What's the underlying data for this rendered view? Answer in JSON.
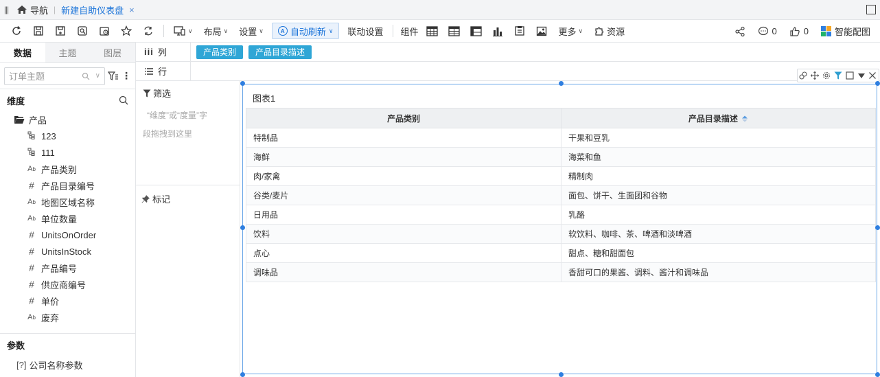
{
  "nav": {
    "home_label": "导航",
    "tab_title": "新建自助仪表盘",
    "tab_close": "×"
  },
  "toolbar": {
    "layout_label": "布局",
    "settings_label": "设置",
    "auto_refresh_label": "自动刷新",
    "auto_refresh_badge": "A",
    "link_settings_label": "联动设置",
    "components_label": "组件",
    "more_label": "更多",
    "resources_label": "资源",
    "comments_count": "0",
    "likes_count": "0",
    "smart_chart_label": "智能配图"
  },
  "left_panel": {
    "tabs": [
      {
        "label": "数据"
      },
      {
        "label": "主题"
      },
      {
        "label": "图层"
      }
    ],
    "subject_placeholder": "订单主题",
    "dimension_heading": "维度",
    "folder_label": "产品",
    "fields": [
      {
        "icon": "hierarchy",
        "label": "123"
      },
      {
        "icon": "hierarchy",
        "label": "111"
      },
      {
        "icon": "text",
        "label": "产品类别"
      },
      {
        "icon": "number",
        "label": "产品目录编号"
      },
      {
        "icon": "text",
        "label": "地图区域名称"
      },
      {
        "icon": "text",
        "label": "单位数量"
      },
      {
        "icon": "number",
        "label": "UnitsOnOrder"
      },
      {
        "icon": "number",
        "label": "UnitsInStock"
      },
      {
        "icon": "number",
        "label": "产品编号"
      },
      {
        "icon": "number",
        "label": "供应商编号"
      },
      {
        "icon": "number",
        "label": "单价"
      },
      {
        "icon": "text",
        "label": "废弃"
      }
    ],
    "params_heading": "参数",
    "param_item_icon": "[?]",
    "param_item_label": "公司名称参数"
  },
  "shelves": {
    "columns_label": "列",
    "rows_label": "行",
    "column_pills": [
      {
        "label": "产品类别"
      },
      {
        "label": "产品目录描述"
      }
    ]
  },
  "middle_panel": {
    "filter_label": "筛选",
    "filter_hint_line1": "“维度”或“度量”字",
    "filter_hint_line2": "段拖拽到这里",
    "mark_label": "标记"
  },
  "chart": {
    "title": "图表1",
    "headers": [
      "产品类别",
      "产品目录描述"
    ],
    "rows": [
      [
        "特制品",
        "干果和豆乳"
      ],
      [
        "海鲜",
        "海菜和鱼"
      ],
      [
        "肉/家禽",
        "精制肉"
      ],
      [
        "谷类/麦片",
        "面包、饼干、生面团和谷物"
      ],
      [
        "日用品",
        "乳酪"
      ],
      [
        "饮料",
        "软饮料、咖啡、茶、啤酒和淡啤酒"
      ],
      [
        "点心",
        "甜点、糖和甜面包"
      ],
      [
        "调味品",
        "香甜可口的果酱、调料、酱汁和调味品"
      ]
    ]
  },
  "colors": {
    "accent": "#1a73d9",
    "pill": "#2fa6d6",
    "selection": "#6ba7e8"
  }
}
